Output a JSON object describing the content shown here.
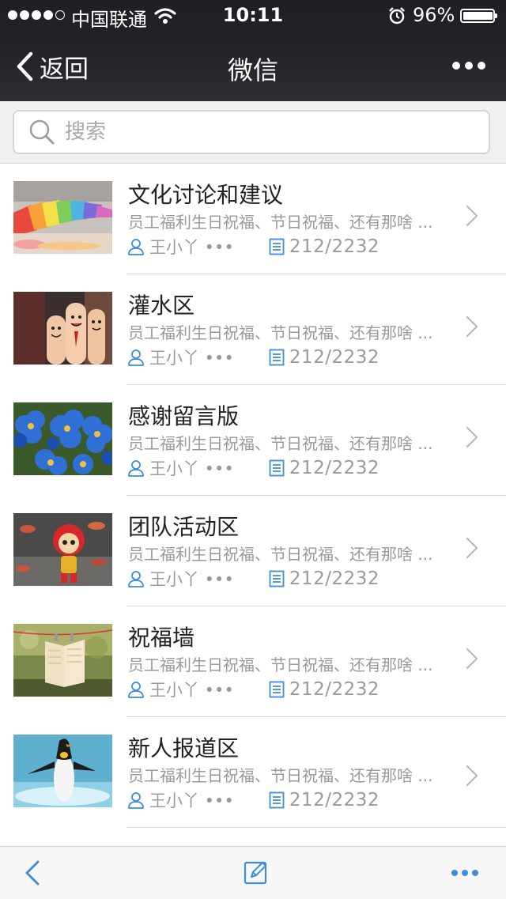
{
  "status_bar": {
    "carrier": "中国联通",
    "time": "10:11",
    "battery": "96%",
    "battery_level": 0.96
  },
  "nav": {
    "back_label": "返回",
    "title": "微信"
  },
  "search": {
    "placeholder": "搜索"
  },
  "list": {
    "items": [
      {
        "title": "文化讨论和建议",
        "desc": "员工福利生日祝福、节日祝福、还有那啥 ...",
        "author": "王小丫 •••",
        "count": "212/2232",
        "thumb": "crayons"
      },
      {
        "title": "灌水区",
        "desc": "员工福利生日祝福、节日祝福、还有那啥 ...",
        "author": "王小丫 •••",
        "count": "212/2232",
        "thumb": "finger-puppets"
      },
      {
        "title": "感谢留言版",
        "desc": "员工福利生日祝福、节日祝福、还有那啥 ...",
        "author": "王小丫 •••",
        "count": "212/2232",
        "thumb": "blue-flowers"
      },
      {
        "title": "团队活动区",
        "desc": "员工福利生日祝福、节日祝福、还有那啥 ...",
        "author": "王小丫 •••",
        "count": "212/2232",
        "thumb": "toy-figure"
      },
      {
        "title": "祝福墙",
        "desc": "员工福利生日祝福、节日祝福、还有那啥 ...",
        "author": "王小丫 •••",
        "count": "212/2232",
        "thumb": "hanging-book"
      },
      {
        "title": "新人报道区",
        "desc": "员工福利生日祝福、节日祝福、还有那啥 ...",
        "author": "王小丫 •••",
        "count": "212/2232",
        "thumb": "penguin"
      }
    ]
  },
  "colors": {
    "header_bg": "#222428",
    "accent": "#3a8fd8",
    "secondary_text": "#9a9a9a"
  }
}
